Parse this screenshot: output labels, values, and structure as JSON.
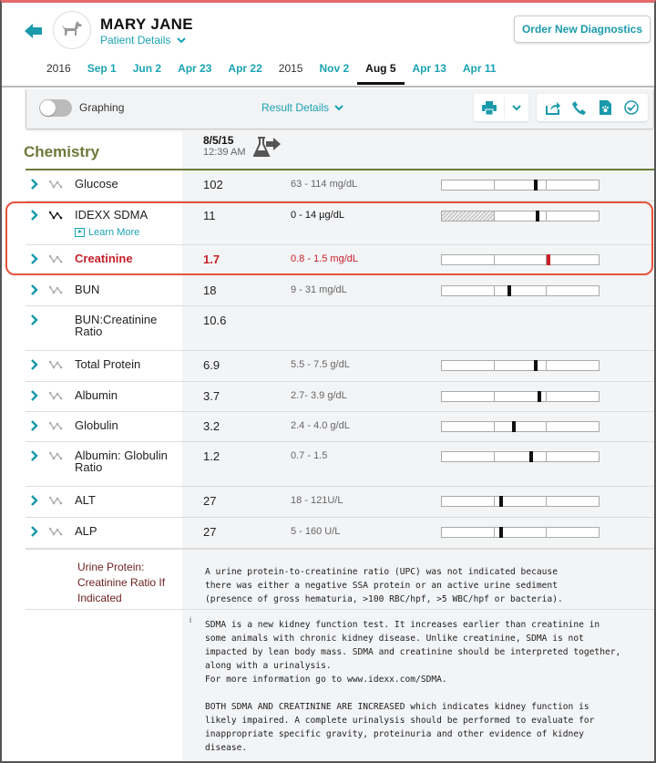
{
  "header": {
    "patient_name": "MARY JANE",
    "patient_details_label": "Patient Details",
    "order_button_label": "Order New Diagnostics"
  },
  "date_tabs": [
    {
      "label": "2016",
      "type": "year"
    },
    {
      "label": "Sep 1",
      "type": "date"
    },
    {
      "label": "Jun 2",
      "type": "date"
    },
    {
      "label": "Apr 23",
      "type": "date"
    },
    {
      "label": "Apr 22",
      "type": "date"
    },
    {
      "label": "2015",
      "type": "year"
    },
    {
      "label": "Nov 2",
      "type": "date"
    },
    {
      "label": "Aug 5",
      "type": "date",
      "active": true
    },
    {
      "label": "Apr 13",
      "type": "date"
    },
    {
      "label": "Apr 11",
      "type": "date"
    }
  ],
  "toolbar": {
    "graphing_label": "Graphing",
    "graphing_on": false,
    "result_details_label": "Result Details",
    "icons": [
      "print-icon",
      "chevron-down-icon",
      "share-icon",
      "phone-icon",
      "pet-record-icon",
      "check-circle-icon"
    ]
  },
  "section": {
    "title": "Chemistry",
    "run_date": "8/5/15",
    "run_time": "12:39 AM"
  },
  "results": [
    {
      "name": "Glucose",
      "value": "102",
      "range": "63 - 114 mg/dL",
      "marker": 0.6,
      "trend": true
    },
    {
      "name": "IDEXX SDMA",
      "value": "11",
      "range": "0 - 14 µg/dL",
      "marker": 0.61,
      "trend": true,
      "learn_more": "Learn More",
      "hatched": true
    },
    {
      "name": "Creatinine",
      "value": "1.7",
      "range": "0.8 - 1.5 mg/dL",
      "marker": 0.68,
      "trend": true,
      "abnormal": true
    },
    {
      "name": "BUN",
      "value": "18",
      "range": "9 - 31 mg/dL",
      "marker": 0.43,
      "trend": true
    },
    {
      "name": "BUN:Creatinine Ratio",
      "value": "10.6",
      "range": "",
      "trend": false
    },
    {
      "name": "Total Protein",
      "value": "6.9",
      "range": "5.5 - 7.5 g/dL",
      "marker": 0.6,
      "trend": true
    },
    {
      "name": "Albumin",
      "value": "3.7",
      "range": "2.7- 3.9 g/dL",
      "marker": 0.62,
      "trend": true
    },
    {
      "name": "Globulin",
      "value": "3.2",
      "range": "2.4 - 4.0 g/dL",
      "marker": 0.46,
      "trend": true
    },
    {
      "name": "Albumin: Globulin Ratio",
      "value": "1.2",
      "range": "0.7 - 1.5",
      "marker": 0.57,
      "trend": true
    },
    {
      "name": "ALT",
      "value": "27",
      "range": "18 - 121U/L",
      "marker": 0.38,
      "trend": true
    },
    {
      "name": "ALP",
      "value": "27",
      "range": "5 - 160 U/L",
      "marker": 0.38,
      "trend": true
    }
  ],
  "notes": {
    "upc_label": "Urine Protein: Creatinine Ratio If Indicated",
    "upc_text": "A urine protein-to-creatinine ratio (UPC) was not indicated because\nthere was either a negative SSA protein or an active urine sediment\n(presence of gross hematuria, >100 RBC/hpf, >5 WBC/hpf or bacteria).",
    "info_marker": "i",
    "sdma_text": "SDMA is a new kidney function test. It increases earlier than creatinine in\nsome animals with chronic kidney disease. Unlike creatinine, SDMA is not\nimpacted by lean body mass. SDMA and creatinine should be interpreted together,\nalong with a urinalysis.\nFor more information go to www.idexx.com/SDMA.\n\nBOTH SDMA AND CREATININE ARE INCREASED which indicates kidney function is\nlikely impaired. A complete urinalysis should be performed to evaluate for\ninappropriate specific gravity, proteinuria and other evidence of kidney\ndisease."
  },
  "colors": {
    "accent": "#1aa3b3",
    "section": "#6b7a3a",
    "abnormal": "#c8202a",
    "highlight": "#e5533b"
  }
}
